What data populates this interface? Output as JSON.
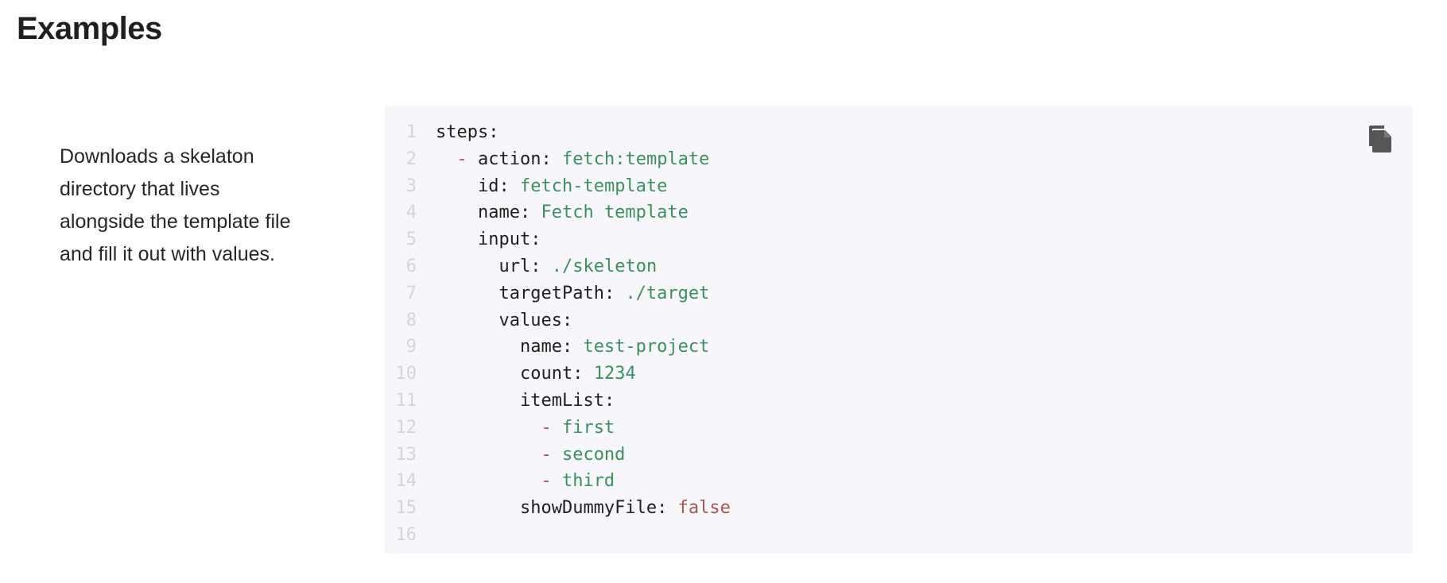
{
  "page": {
    "title": "Examples"
  },
  "example": {
    "description": "Downloads a skelaton directory that lives alongside the template file and fill it out with values.",
    "copy_icon": "copy-icon",
    "code_lines": [
      {
        "number": "1",
        "indent": "",
        "dash": "",
        "key": "steps",
        "sep": ":",
        "value": "",
        "value_type": ""
      },
      {
        "number": "2",
        "indent": "  ",
        "dash": "- ",
        "key": "action",
        "sep": ": ",
        "value": "fetch:template",
        "value_type": "str"
      },
      {
        "number": "3",
        "indent": "    ",
        "dash": "",
        "key": "id",
        "sep": ": ",
        "value": "fetch-template",
        "value_type": "str"
      },
      {
        "number": "4",
        "indent": "    ",
        "dash": "",
        "key": "name",
        "sep": ": ",
        "value": "Fetch template",
        "value_type": "str"
      },
      {
        "number": "5",
        "indent": "    ",
        "dash": "",
        "key": "input",
        "sep": ":",
        "value": "",
        "value_type": ""
      },
      {
        "number": "6",
        "indent": "      ",
        "dash": "",
        "key": "url",
        "sep": ": ",
        "value": "./skeleton",
        "value_type": "str"
      },
      {
        "number": "7",
        "indent": "      ",
        "dash": "",
        "key": "targetPath",
        "sep": ": ",
        "value": "./target",
        "value_type": "str"
      },
      {
        "number": "8",
        "indent": "      ",
        "dash": "",
        "key": "values",
        "sep": ":",
        "value": "",
        "value_type": ""
      },
      {
        "number": "9",
        "indent": "        ",
        "dash": "",
        "key": "name",
        "sep": ": ",
        "value": "test-project",
        "value_type": "str"
      },
      {
        "number": "10",
        "indent": "        ",
        "dash": "",
        "key": "count",
        "sep": ": ",
        "value": "1234",
        "value_type": "num"
      },
      {
        "number": "11",
        "indent": "        ",
        "dash": "",
        "key": "itemList",
        "sep": ":",
        "value": "",
        "value_type": ""
      },
      {
        "number": "12",
        "indent": "          ",
        "dash": "- ",
        "key": "",
        "sep": "",
        "value": "first",
        "value_type": "str"
      },
      {
        "number": "13",
        "indent": "          ",
        "dash": "- ",
        "key": "",
        "sep": "",
        "value": "second",
        "value_type": "str"
      },
      {
        "number": "14",
        "indent": "          ",
        "dash": "- ",
        "key": "",
        "sep": "",
        "value": "third",
        "value_type": "str"
      },
      {
        "number": "15",
        "indent": "        ",
        "dash": "",
        "key": "showDummyFile",
        "sep": ": ",
        "value": "false",
        "value_type": "bool"
      },
      {
        "number": "16",
        "indent": "",
        "dash": "",
        "key": "",
        "sep": "",
        "value": "",
        "value_type": ""
      }
    ]
  },
  "colors": {
    "code_background": "#f7f7fb",
    "line_number": "#d3d3d8",
    "string_value": "#3d8f5f",
    "boolean_value": "#a3584e",
    "list_dash": "#c0407a",
    "icon": "#555555"
  }
}
